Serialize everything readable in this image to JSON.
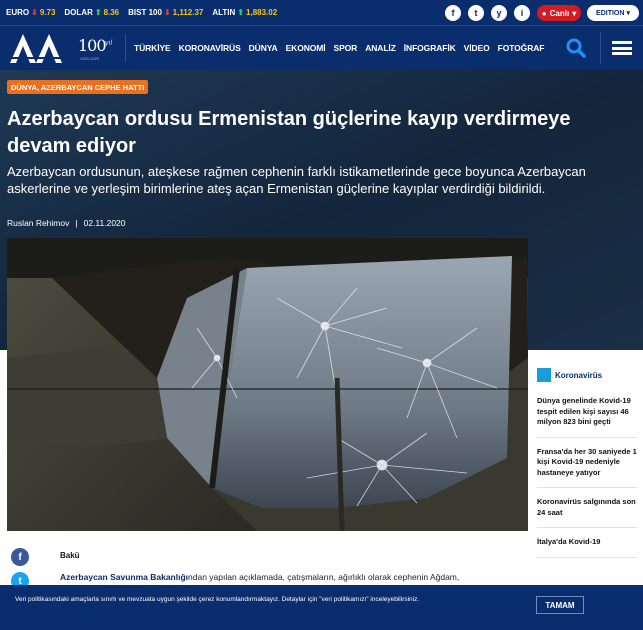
{
  "ticker": {
    "items": [
      {
        "label": "EURO",
        "direction": "down",
        "value": "9.73"
      },
      {
        "label": "DOLAR",
        "direction": "up",
        "value": "8.36"
      },
      {
        "label": "BIST 100",
        "direction": "down",
        "value": "1,112.37"
      },
      {
        "label": "ALTIN",
        "direction": "up",
        "value": "1,883.02"
      }
    ],
    "social": [
      "f",
      "t",
      "y",
      "i"
    ],
    "live_label": "Canlı",
    "edition_label": "EDITION"
  },
  "nav": {
    "logo_text": "AA",
    "anniversary": "100",
    "anniversary_suffix": "yıl",
    "anniversary_years": "1920-2020",
    "items": [
      "TÜRKİYE",
      "KORONAVİRÜS",
      "DÜNYA",
      "EKONOMİ",
      "SPOR",
      "ANALİZ",
      "İNFOGRAFİK",
      "VİDEO",
      "FOTOĞRAF"
    ]
  },
  "article": {
    "category": "DÜNYA, AZERBAYCAN CEPHE HATTI",
    "headline": "Azerbaycan ordusu Ermenistan güçlerine kayıp verdirmeye devam ediyor",
    "summary": "Azerbaycan ordusunun, ateşkese rağmen cephenin farklı istikametlerinde gece boyunca Azerbaycan askerlerine ve yerleşim birimlerine ateş açan Ermenistan güçlerine kayıplar verdirdiği bildirildi.",
    "author": "Ruslan Rehimov",
    "separator": "|",
    "date": "02.11.2020",
    "dateline": "Bakü",
    "body_bold": "Azerbaycan Savunma Bakanlığı",
    "body_rest": "ndan yapılan açıklamada, çatışmaların, ağırlıklı olarak cephenin Ağdam,"
  },
  "sidebar": {
    "title": "Koronavirüs",
    "items": [
      "Dünya genelinde Kovid-19 tespit edilen kişi sayısı 46 milyon 823 bini geçti",
      "Fransa'da her 30 saniyede 1 kişi Kovid-19 nedeniyle hastaneye yatıyor",
      "Koronavirüs salgınında son 24 saat",
      "İtalya'da Kovid-19"
    ]
  },
  "share": [
    "f",
    "t"
  ],
  "cookie": {
    "text": "Veri politikasındaki amaçlarla sınırlı ve mevzuata uygun şekilde çerez konumlandırmaktayız. Detaylar için \"veri politikamızı\" inceleyebilirsiniz.",
    "button": "TAMAM"
  },
  "colors": {
    "navy": "#0a2d6e",
    "orange": "#e8701e",
    "live_red": "#d71920",
    "sidebar_flag": "#1a9bdc"
  }
}
